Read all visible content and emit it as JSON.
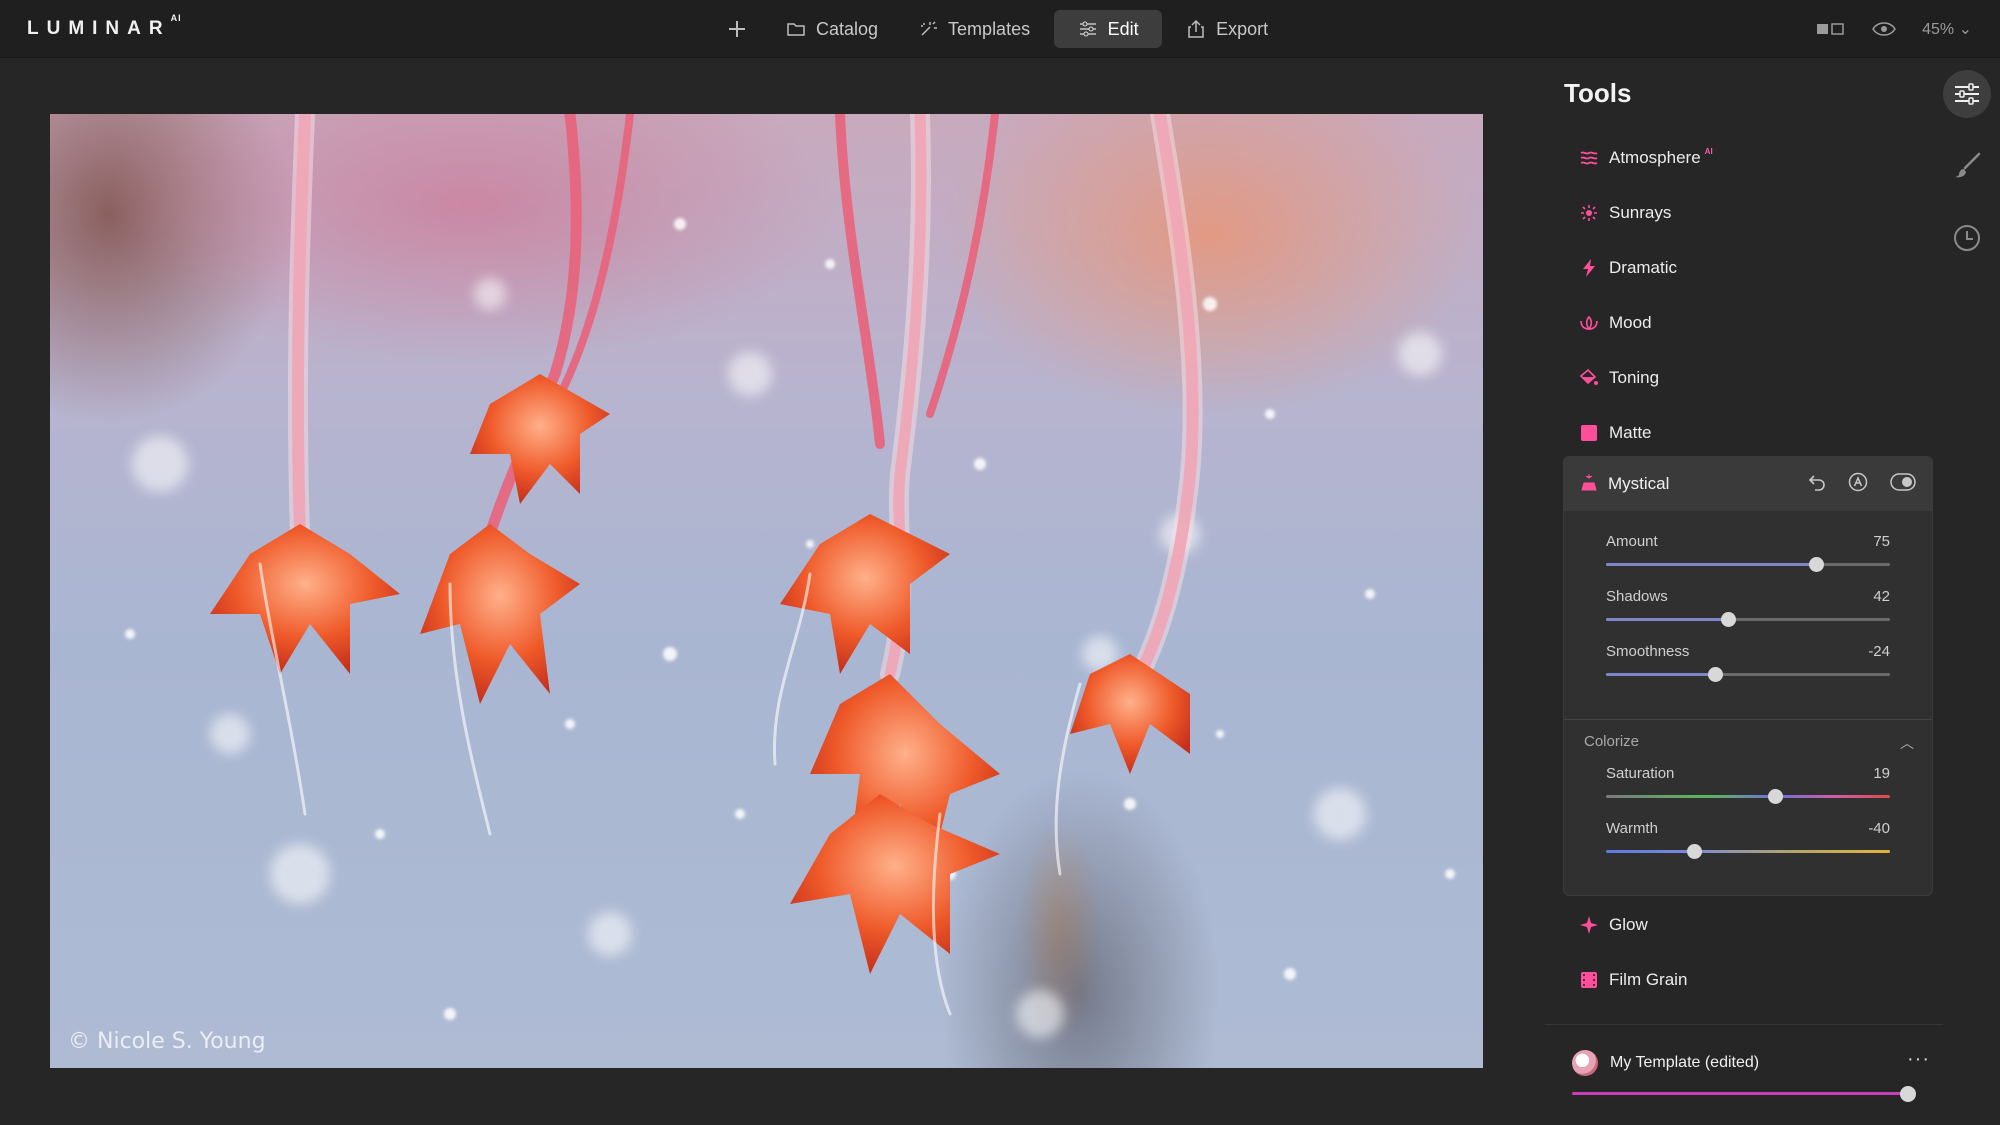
{
  "app": {
    "logo": "LUMINAR",
    "logo_suffix": "AI"
  },
  "nav": {
    "items": [
      {
        "label": "Catalog",
        "icon": "folder-icon"
      },
      {
        "label": "Templates",
        "icon": "sparkle-icon"
      },
      {
        "label": "Edit",
        "icon": "sliders-icon",
        "active": true
      },
      {
        "label": "Export",
        "icon": "share-icon"
      }
    ]
  },
  "toolbar_right": {
    "zoom": "45%"
  },
  "photo": {
    "watermark": "© Nicole S. Young"
  },
  "tools": {
    "title": "Tools",
    "items_top": [
      {
        "label": "Atmosphere",
        "icon": "waves-icon",
        "badge": "AI"
      },
      {
        "label": "Sunrays",
        "icon": "sun-icon"
      },
      {
        "label": "Dramatic",
        "icon": "bolt-icon"
      },
      {
        "label": "Mood",
        "icon": "lotus-icon"
      },
      {
        "label": "Toning",
        "icon": "bucket-icon"
      },
      {
        "label": "Matte",
        "icon": "square-icon"
      }
    ],
    "mystical": {
      "label": "Mystical",
      "sliders": [
        {
          "label": "Amount",
          "value": "75",
          "pos": 0.74
        },
        {
          "label": "Shadows",
          "value": "42",
          "pos": 0.43
        },
        {
          "label": "Smoothness",
          "value": "-24",
          "pos": 0.385
        }
      ],
      "colorize": {
        "label": "Colorize",
        "sliders": [
          {
            "label": "Saturation",
            "value": "19",
            "pos": 0.595
          },
          {
            "label": "Warmth",
            "value": "-40",
            "pos": 0.31
          }
        ]
      }
    },
    "items_bottom": [
      {
        "label": "Glow",
        "icon": "glow-icon"
      },
      {
        "label": "Film Grain",
        "icon": "film-icon"
      }
    ]
  },
  "template": {
    "name": "My Template (edited)",
    "amount": 1.0
  },
  "colors": {
    "accent": "#ff4f9a",
    "bg": "#262626"
  }
}
